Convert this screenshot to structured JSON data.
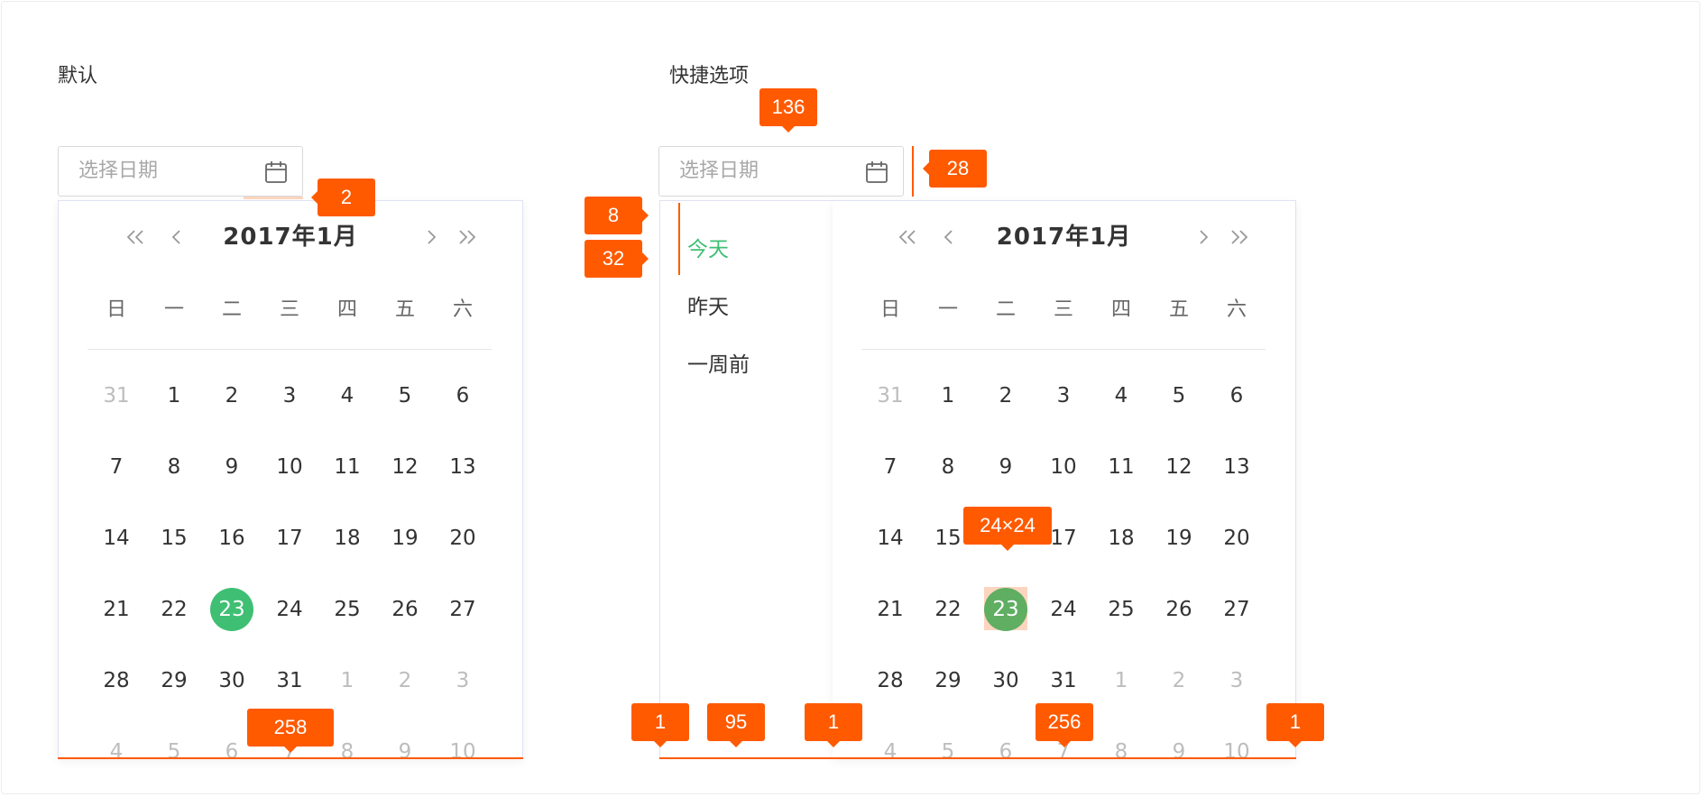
{
  "sections": {
    "default": {
      "label": "默认"
    },
    "shortcuts": {
      "label": "快捷选项"
    }
  },
  "date_input": {
    "placeholder": "选择日期",
    "icon": "calendar-icon"
  },
  "calendar": {
    "title": "2017年1月",
    "weekdays": [
      "日",
      "一",
      "二",
      "三",
      "四",
      "五",
      "六"
    ],
    "weeks": [
      [
        "31",
        "1",
        "2",
        "3",
        "4",
        "5",
        "6"
      ],
      [
        "7",
        "8",
        "9",
        "10",
        "11",
        "12",
        "13"
      ],
      [
        "14",
        "15",
        "16",
        "17",
        "18",
        "19",
        "20"
      ],
      [
        "21",
        "22",
        "23",
        "24",
        "25",
        "26",
        "27"
      ],
      [
        "28",
        "29",
        "30",
        "31",
        "1",
        "2",
        "3"
      ],
      [
        "4",
        "5",
        "6",
        "7",
        "8",
        "9",
        "10"
      ]
    ],
    "selected_day": "23",
    "selected_color": "#3fbf73",
    "muted_color": "#bdbdbd"
  },
  "shortcut_options": [
    {
      "label": "今天",
      "active": true
    },
    {
      "label": "昨天",
      "active": false
    },
    {
      "label": "一周前",
      "active": false
    }
  ],
  "annotations": {
    "color": "#ff5a00",
    "default_gap": "2",
    "default_width": "258",
    "shortcut_input_width": "136",
    "shortcut_gap": "28",
    "shortcut_indicator_top": "8",
    "shortcut_indicator_height": "32",
    "sidebar_left_border": "1",
    "sidebar_width": "95",
    "divider_width": "1",
    "selected_day_size": "24×24",
    "calendar_width": "256",
    "right_border": "1"
  }
}
